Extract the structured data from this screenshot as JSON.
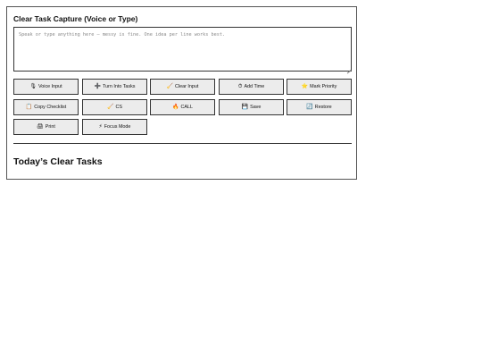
{
  "title": "Clear Task Capture (Voice or Type)",
  "input": {
    "placeholder": "Speak or type anything here — messy is fine. One idea per line works best.",
    "value": ""
  },
  "buttons": [
    {
      "icon": "🎙",
      "icon_name": "microphone-icon",
      "label": "Voice Input"
    },
    {
      "icon": "➕",
      "icon_name": "plus-icon",
      "label": "Turn Into Tasks"
    },
    {
      "icon": "🧹",
      "icon_name": "broom-icon",
      "label": "Clear Input"
    },
    {
      "icon": "⏱",
      "icon_name": "stopwatch-icon",
      "label": "Add Time"
    },
    {
      "icon": "⭐",
      "icon_name": "star-icon",
      "label": "Mark Priority"
    },
    {
      "icon": "📋",
      "icon_name": "clipboard-icon",
      "label": "Copy Checklist"
    },
    {
      "icon": "🧹",
      "icon_name": "broom-icon",
      "label": "CS"
    },
    {
      "icon": "🔥",
      "icon_name": "fire-icon",
      "label": "CALL"
    },
    {
      "icon": "💾",
      "icon_name": "floppy-disk-icon",
      "label": "Save"
    },
    {
      "icon": "🔄",
      "icon_name": "restore-icon",
      "label": "Restore"
    },
    {
      "icon": "🖨",
      "icon_name": "printer-icon",
      "label": "Print"
    },
    {
      "icon": "⚡",
      "icon_name": "lightning-icon",
      "label": "Focus Mode"
    }
  ],
  "tasks": {
    "heading": "Today’s Clear Tasks",
    "items": []
  }
}
